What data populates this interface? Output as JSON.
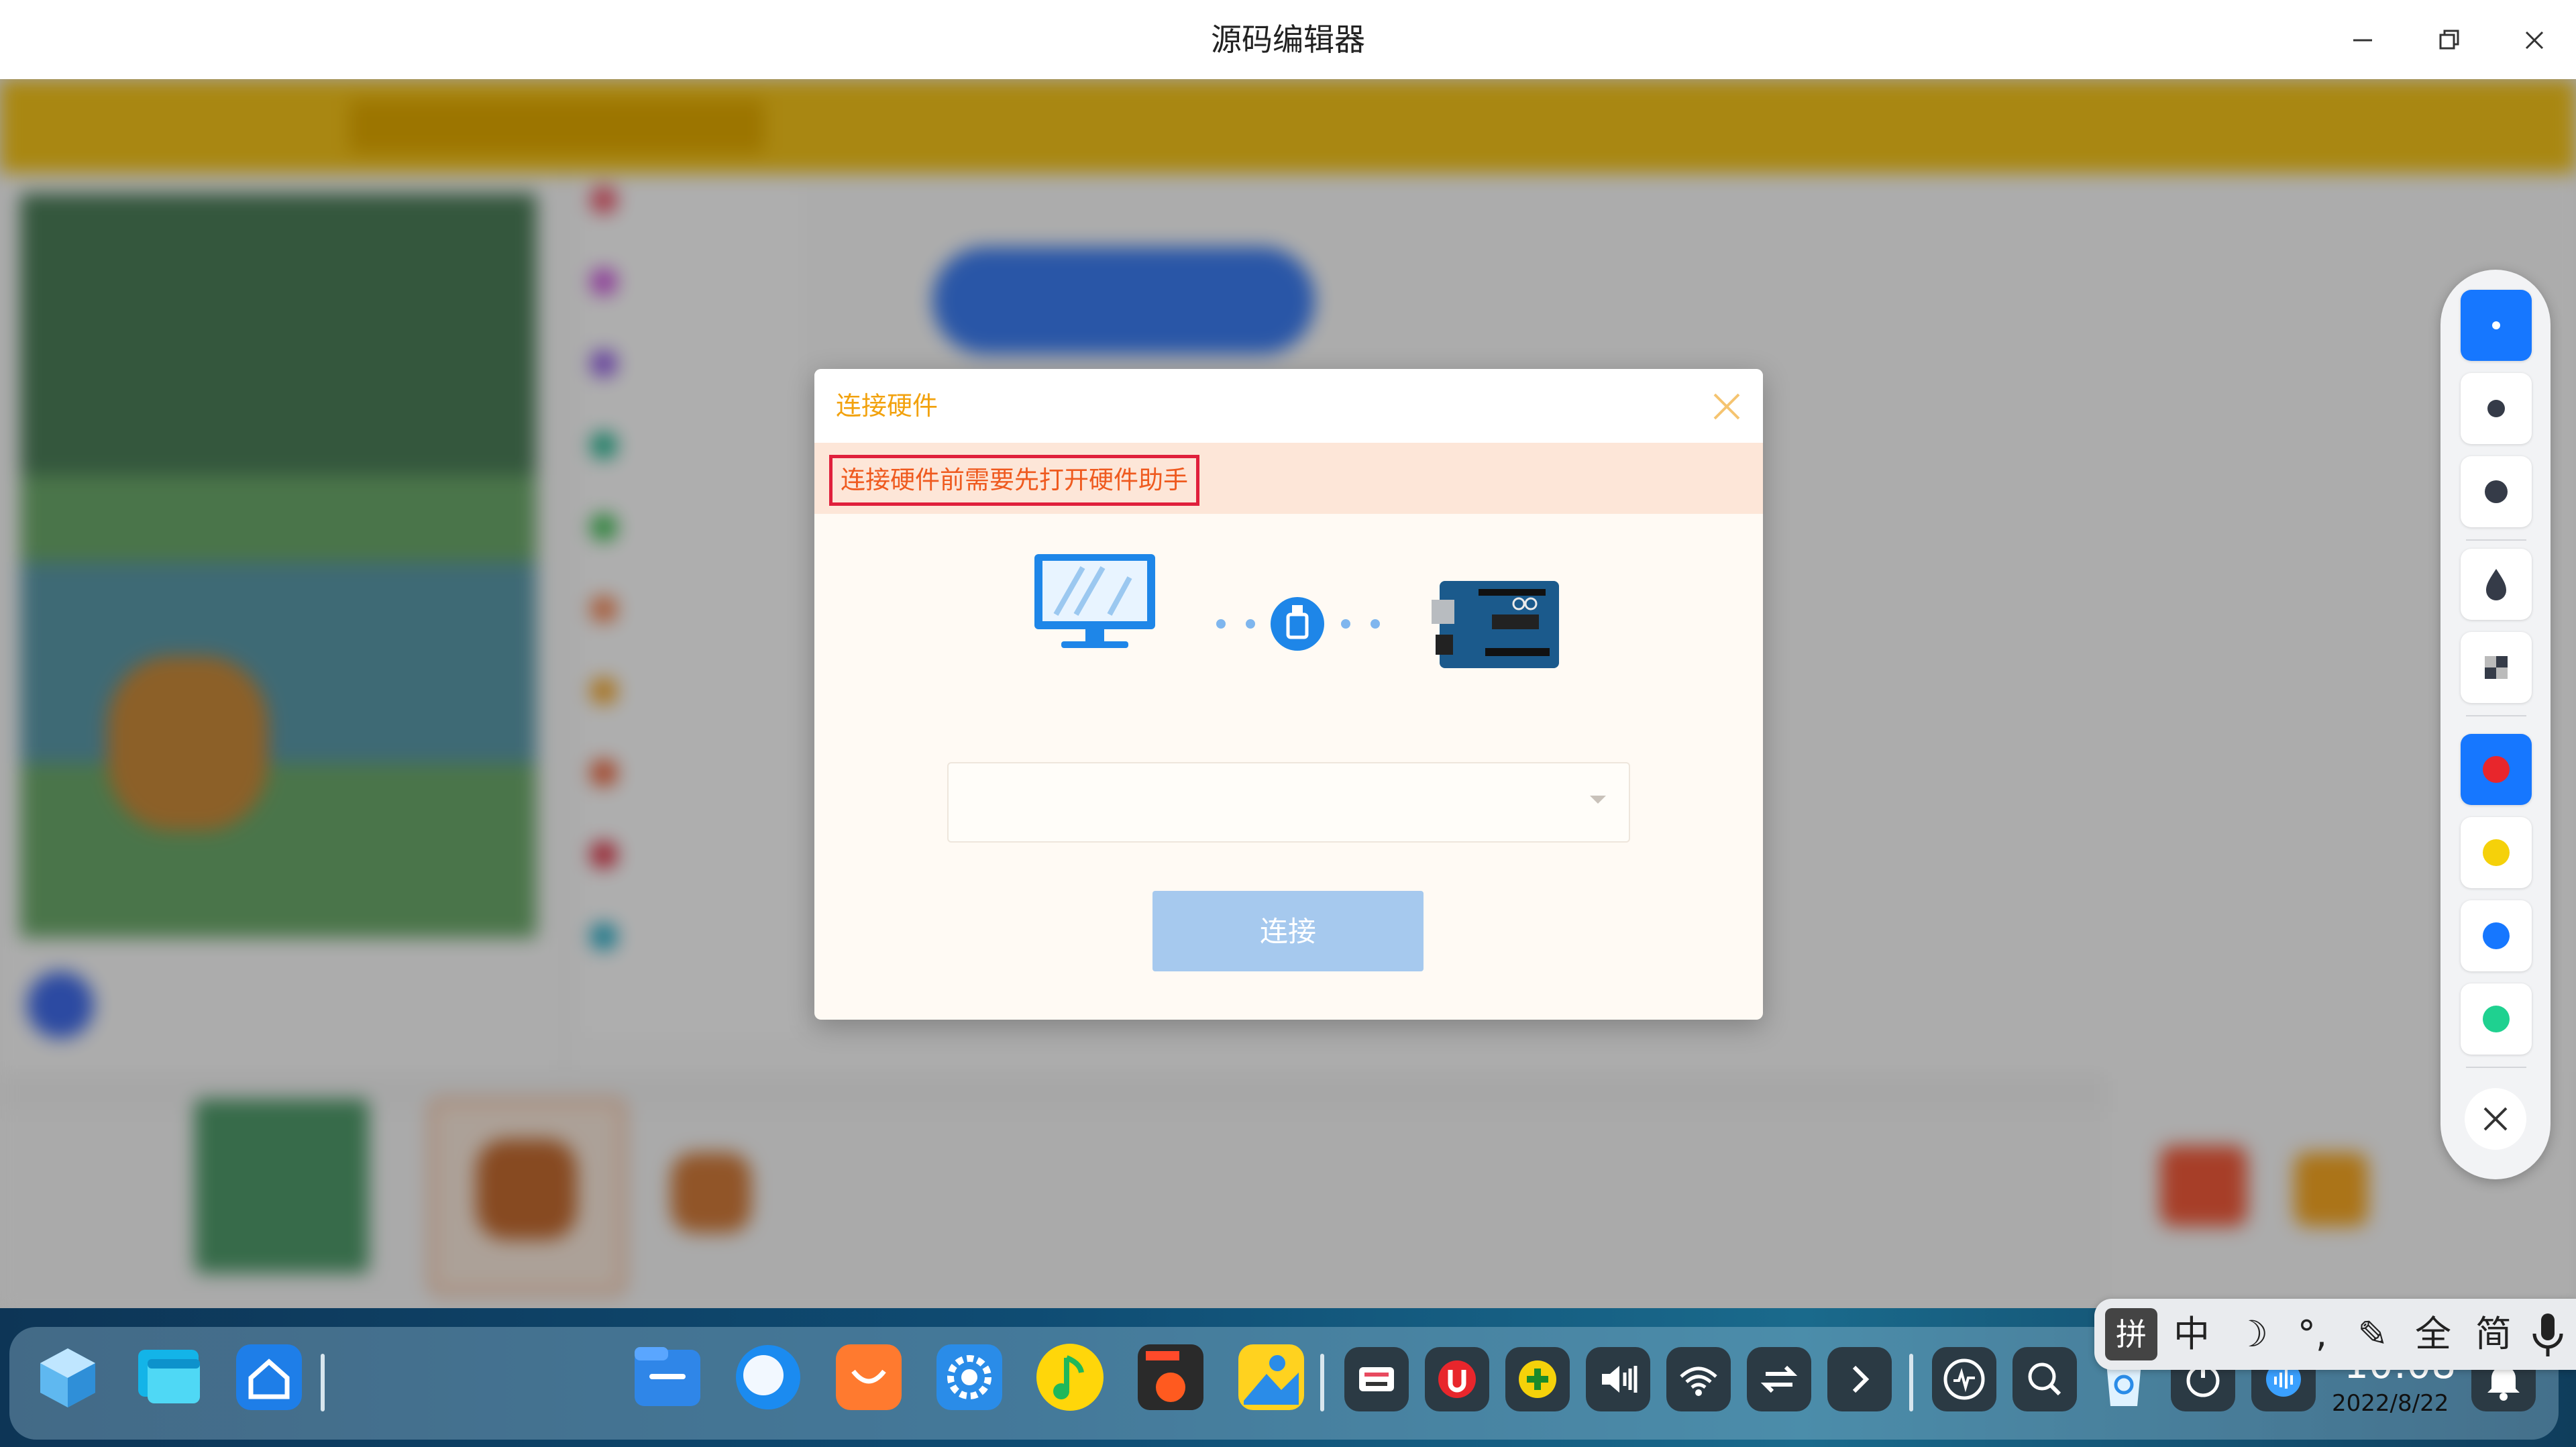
{
  "window": {
    "title": "源码编辑器",
    "controls": [
      "minimize-icon",
      "restore-icon",
      "close-icon"
    ]
  },
  "dialog": {
    "title": "连接硬件",
    "warning": "连接硬件前需要先打开硬件助手",
    "port_select_value": "",
    "connect_label": "连接",
    "icons": [
      "monitor-icon",
      "usb-plug-icon",
      "arduino-board-icon",
      "close-icon"
    ]
  },
  "draw_toolbar": {
    "colors": {
      "red": "#e8262c",
      "yellow": "#f5d10a",
      "blue": "#1677ff",
      "green": "#1fd190"
    },
    "icons": [
      "pen-small-icon",
      "pen-medium-icon",
      "pen-large-icon",
      "ink-drop-icon",
      "eraser-pattern-icon",
      "close-icon"
    ]
  },
  "taskbar": {
    "apps": [
      "cube-icon",
      "windows-icon",
      "home-icon",
      "file-manager-icon",
      "browser-icon",
      "app-store-icon",
      "settings-icon",
      "music-icon",
      "cpu-monitor-icon",
      "image-viewer-icon"
    ],
    "tray": [
      "keyboard-icon",
      "u-icon",
      "plus-icon",
      "volume-icon",
      "wifi-icon",
      "transfer-icon",
      "chevron-right-icon",
      "monitor-wave-icon",
      "search-icon",
      "recycle-icon",
      "power-icon",
      "assistant-icon",
      "bell-icon"
    ],
    "clock": {
      "time": "10:08",
      "date": "2022/8/22"
    }
  },
  "ime": {
    "keys": [
      "拼",
      "中",
      "☽",
      "°,",
      "✎",
      "全",
      "简"
    ],
    "icons": [
      "moon-icon",
      "pen-icon",
      "microphone-icon"
    ]
  }
}
